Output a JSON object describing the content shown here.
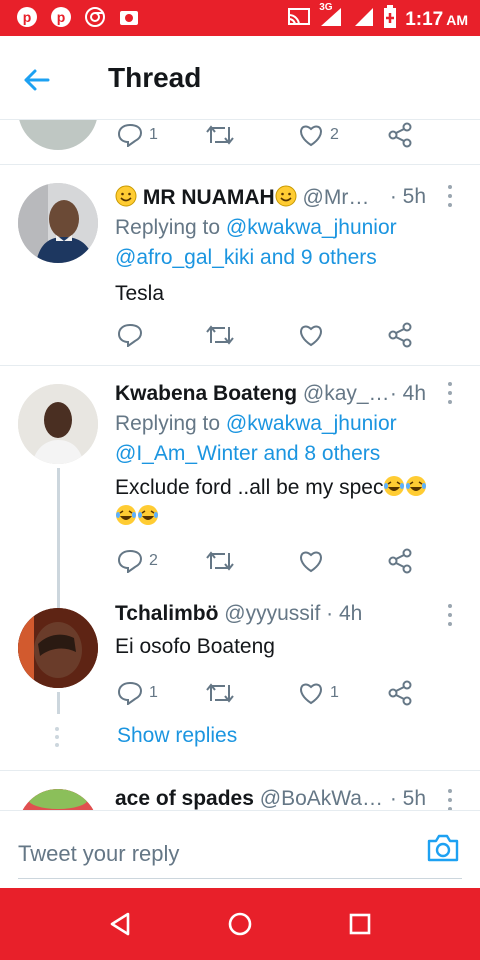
{
  "status_bar": {
    "time": "1:17",
    "ampm": "AM",
    "network": "3G",
    "left_icons": [
      "pinterest-icon",
      "pinterest-icon",
      "chrome-icon",
      "camera-notification-icon"
    ],
    "right_icons": [
      "cast-icon",
      "signal-3g-icon",
      "signal-icon",
      "battery-icon"
    ],
    "color": "#e8202a"
  },
  "header": {
    "title": "Thread",
    "back_icon": "arrow-left-icon",
    "accent": "#1da1f2"
  },
  "partial_tweet_top": {
    "reply_count": "1",
    "like_count": "2"
  },
  "tweets": [
    {
      "display_name": "MR NUAMAH",
      "handle": "@Mr…",
      "time": "· 5h",
      "replying_prefix": "Replying to",
      "reply_user": "@kwakwa_jhunior",
      "reply_others": "@afro_gal_kiki and 9 others",
      "text": "Tesla",
      "reply_count": "",
      "like_count": ""
    },
    {
      "display_name": "Kwabena Boateng",
      "handle": "@kay_…",
      "time": "· 4h",
      "replying_prefix": "Replying to",
      "reply_user": "@kwakwa_jhunior",
      "reply_others": "@I_Am_Winter and 8 others",
      "text": "Exclude ford ..all be my spec",
      "reply_count": "2",
      "like_count": ""
    },
    {
      "display_name": "Tchalimbö",
      "handle": "@yyyussif",
      "time": "· 4h",
      "text": "Ei osofo Boateng",
      "reply_count": "1",
      "like_count": "1"
    },
    {
      "display_name": "ace of spades",
      "handle": "@BoAkWa…",
      "time": "· 5h"
    }
  ],
  "show_replies": "Show replies",
  "composer": {
    "placeholder": "Tweet your reply",
    "camera_icon": "camera-icon"
  },
  "nav": {
    "icons": [
      "back-triangle-icon",
      "home-circle-icon",
      "recents-square-icon"
    ]
  },
  "colors": {
    "link": "#1b95e0",
    "muted": "#657786",
    "brand_red": "#e8202a"
  }
}
